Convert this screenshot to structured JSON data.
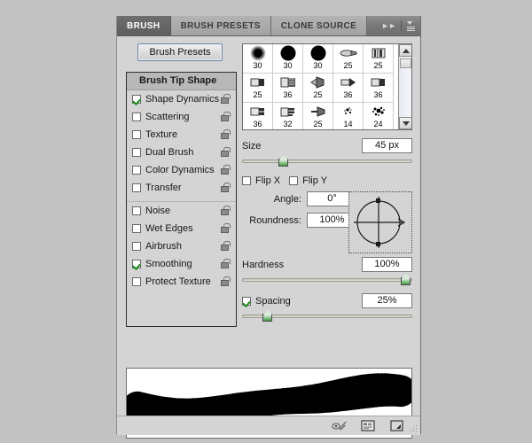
{
  "panel": {
    "tabs": [
      {
        "label": "BRUSH",
        "active": true
      },
      {
        "label": "BRUSH PRESETS",
        "active": false
      },
      {
        "label": "CLONE SOURCE",
        "active": false
      }
    ],
    "collapse_icon": "double-chevron-right-icon",
    "menu_icon": "panel-menu-icon"
  },
  "sidebar": {
    "presets_button": "Brush Presets",
    "header": "Brush Tip Shape",
    "items": [
      {
        "label": "Shape Dynamics",
        "checked": true,
        "locked": true,
        "group_start": false
      },
      {
        "label": "Scattering",
        "checked": false,
        "locked": true,
        "group_start": false
      },
      {
        "label": "Texture",
        "checked": false,
        "locked": true,
        "group_start": false
      },
      {
        "label": "Dual Brush",
        "checked": false,
        "locked": true,
        "group_start": false
      },
      {
        "label": "Color Dynamics",
        "checked": false,
        "locked": true,
        "group_start": false
      },
      {
        "label": "Transfer",
        "checked": false,
        "locked": true,
        "group_start": false
      },
      {
        "label": "Noise",
        "checked": false,
        "locked": true,
        "group_start": true
      },
      {
        "label": "Wet Edges",
        "checked": false,
        "locked": true,
        "group_start": false
      },
      {
        "label": "Airbrush",
        "checked": false,
        "locked": true,
        "group_start": false
      },
      {
        "label": "Smoothing",
        "checked": true,
        "locked": true,
        "group_start": false
      },
      {
        "label": "Protect Texture",
        "checked": false,
        "locked": true,
        "group_start": false
      }
    ]
  },
  "presets": {
    "brushes": [
      {
        "size": "30",
        "shape": "soft-round"
      },
      {
        "size": "30",
        "shape": "hard-round"
      },
      {
        "size": "30",
        "shape": "hard-round"
      },
      {
        "size": "25",
        "shape": "flat-tip"
      },
      {
        "size": "25",
        "shape": "bristle-block"
      },
      {
        "size": "25",
        "shape": "flat-block"
      },
      {
        "size": "36",
        "shape": "angled-bristle"
      },
      {
        "size": "25",
        "shape": "fan"
      },
      {
        "size": "36",
        "shape": "pointed-flat"
      },
      {
        "size": "36",
        "shape": "flat-block"
      },
      {
        "size": "36",
        "shape": "chisel"
      },
      {
        "size": "32",
        "shape": "stepped-flat"
      },
      {
        "size": "25",
        "shape": "fan-thin"
      },
      {
        "size": "14",
        "shape": "spatter"
      },
      {
        "size": "24",
        "shape": "spatter-large"
      }
    ],
    "scroll_up_icon": "scroll-up-arrow-icon",
    "scroll_down_icon": "scroll-down-arrow-icon"
  },
  "controls": {
    "size": {
      "label": "Size",
      "value": "45 px",
      "slider_percent": 23
    },
    "flip_x": {
      "label": "Flip X",
      "checked": false
    },
    "flip_y": {
      "label": "Flip Y",
      "checked": false
    },
    "angle": {
      "label": "Angle:",
      "value": "0°"
    },
    "roundness": {
      "label": "Roundness:",
      "value": "100%"
    },
    "hardness": {
      "label": "Hardness",
      "value": "100%",
      "slider_percent": 100
    },
    "spacing": {
      "label": "Spacing",
      "value": "25%",
      "checked": true,
      "slider_percent": 13
    }
  },
  "footer": {
    "icons": [
      {
        "name": "toggle-brush-preview-icon"
      },
      {
        "name": "preset-manager-icon"
      },
      {
        "name": "new-brush-icon"
      }
    ]
  },
  "colors": {
    "background": "#c2c2c2",
    "panel": "#d4d4d4",
    "tab_active": "#6e6e6e",
    "check_green": "#1a8a1a",
    "slider_green": "#3f9c3f"
  }
}
